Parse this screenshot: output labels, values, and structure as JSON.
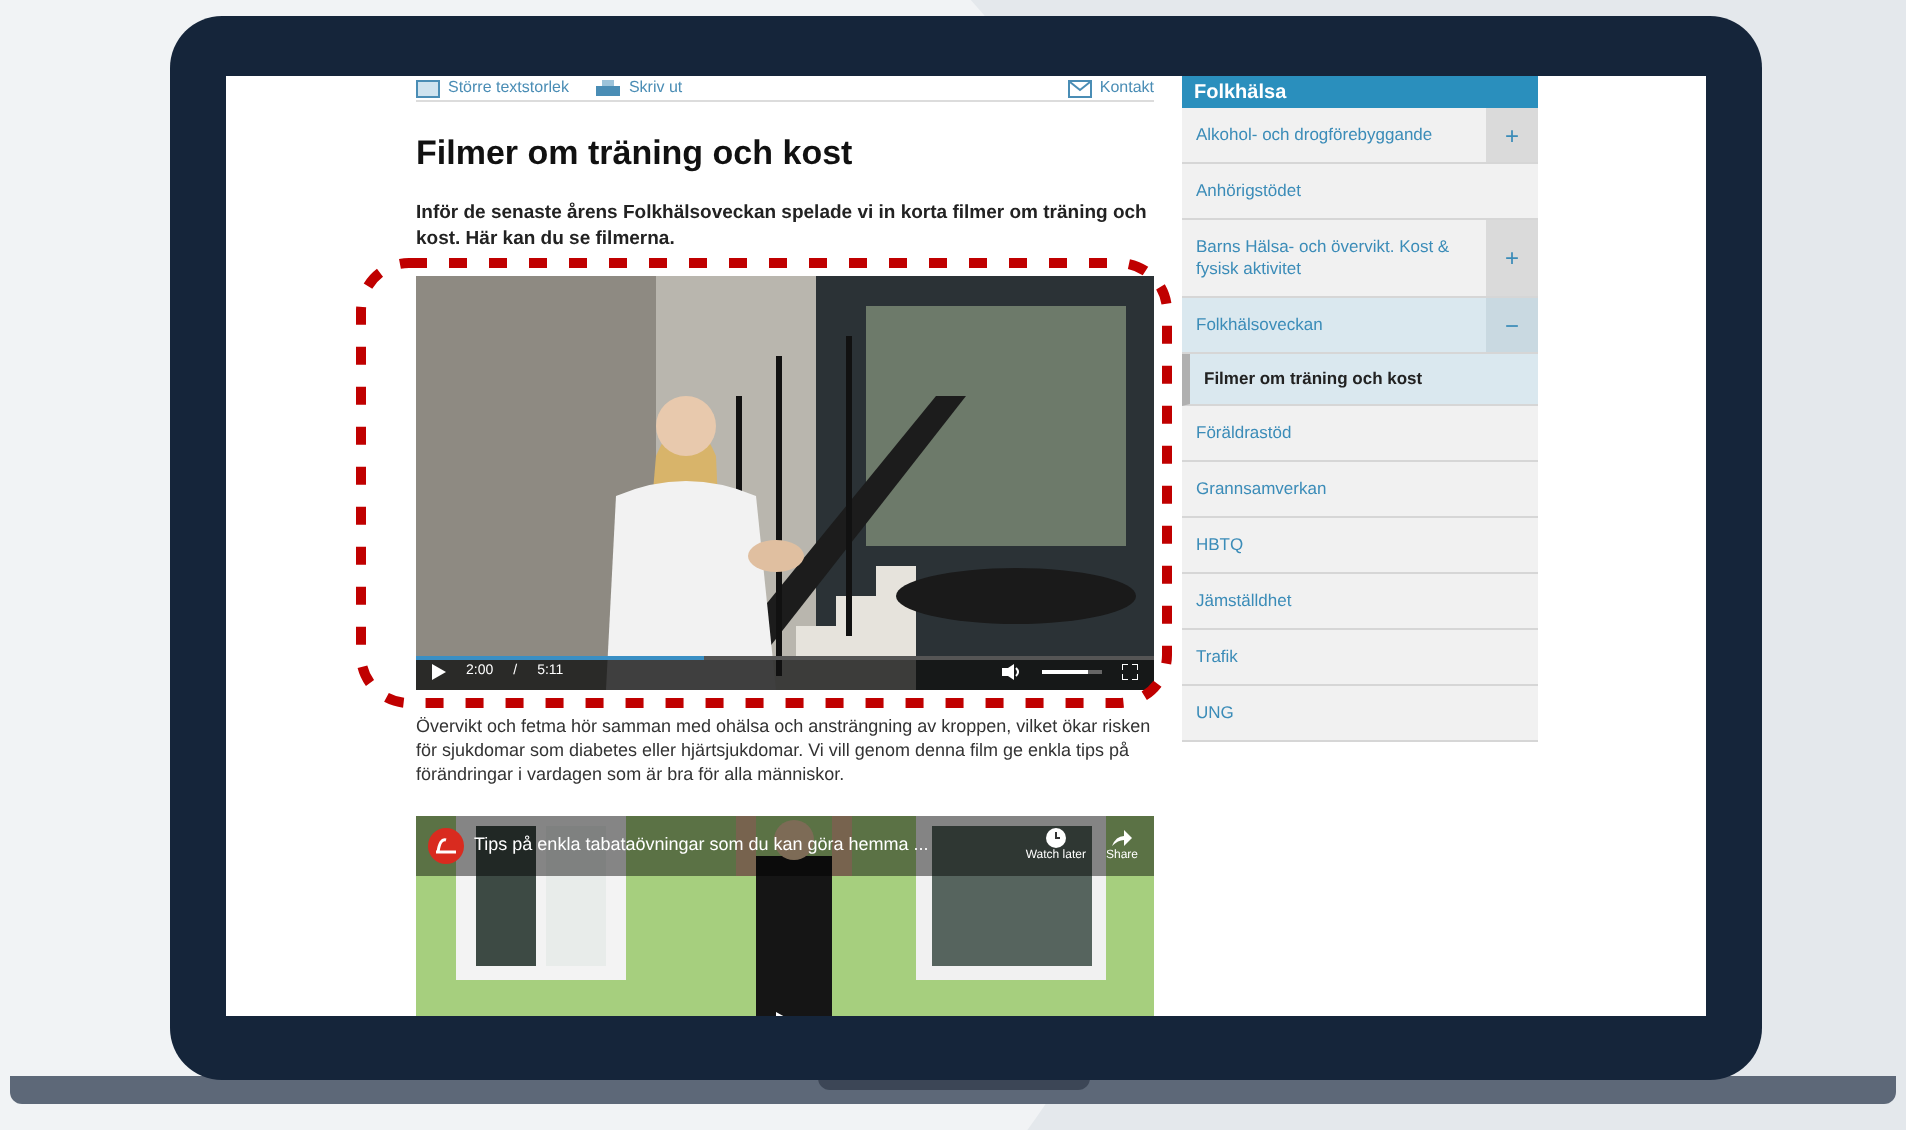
{
  "toolbar": {
    "items": [
      {
        "label": "Större textstorlek",
        "kind": "text-size"
      },
      {
        "label": "Skriv ut",
        "kind": "print"
      },
      {
        "label": "Kontakt",
        "kind": "contact"
      }
    ]
  },
  "article": {
    "title": "Filmer om träning och kost",
    "intro": "Inför de senaste årens Folkhälsoveckan spelade vi in korta filmer om träning och kost. Här kan du se filmerna.",
    "video_1": {
      "elapsed": "2:00",
      "separator": "/",
      "duration": "5:11",
      "progress": {
        "level": 0.39
      },
      "volume": {
        "level": 0.75
      }
    },
    "body": "Övervikt och fetma hör samman med ohälsa och ansträngning av kroppen, vilket ökar risken för sjukdomar som diabetes eller hjärtsjukdomar. Vi vill genom denna film ge enkla tips på förändringar i vardagen som är bra för alla människor.",
    "video_2": {
      "title": "Tips på enkla tabataövningar som du kan göra hemma ...",
      "watch_later": "Watch later",
      "share": "Share"
    }
  },
  "sidebar": {
    "title": "Folkhälsa",
    "items": [
      {
        "label": "Alkohol- och drogförebyggande",
        "toggle": "+",
        "expanded": false,
        "selected": false
      },
      {
        "label": "Anhörigstödet",
        "expanded": false,
        "selected": false
      },
      {
        "label": "Barns Hälsa- och övervikt. Kost & fysisk aktivitet",
        "toggle": "+",
        "expanded": false,
        "selected": false
      },
      {
        "label": "Folkhälsoveckan",
        "toggle": "−",
        "expanded": true,
        "selected": false,
        "children": [
          {
            "label": "Filmer om träning och kost",
            "selected": true
          }
        ]
      },
      {
        "label": "Föräldrastöd",
        "expanded": false,
        "selected": false
      },
      {
        "label": "Grannsamverkan",
        "expanded": false,
        "selected": false
      },
      {
        "label": "HBTQ",
        "expanded": false,
        "selected": false
      },
      {
        "label": "Jämställdhet",
        "expanded": false,
        "selected": false
      },
      {
        "label": "Trafik",
        "expanded": false,
        "selected": false
      },
      {
        "label": "UNG",
        "expanded": false,
        "selected": false
      }
    ]
  }
}
